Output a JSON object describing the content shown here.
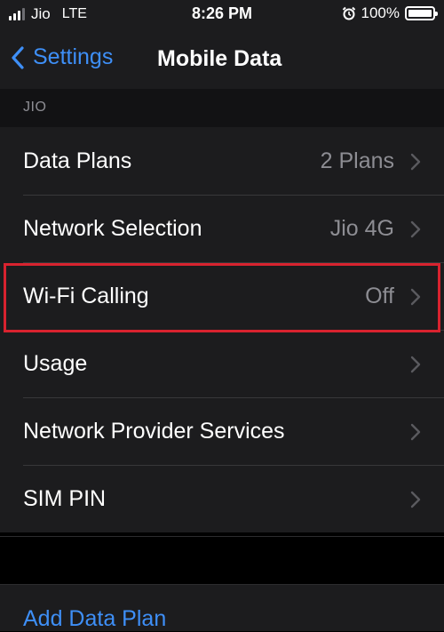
{
  "status_bar": {
    "carrier": "Jio",
    "network": "LTE",
    "time": "8:26 PM",
    "battery": "100%",
    "icons": [
      "signal-bars-icon",
      "alarm-icon",
      "battery-icon"
    ]
  },
  "nav": {
    "back_label": "Settings",
    "title": "Mobile Data"
  },
  "section": {
    "header": "JIO"
  },
  "rows": [
    {
      "label": "Data Plans",
      "value": "2 Plans"
    },
    {
      "label": "Network Selection",
      "value": "Jio 4G"
    },
    {
      "label": "Wi-Fi Calling",
      "value": "Off"
    },
    {
      "label": "Usage",
      "value": ""
    },
    {
      "label": "Network Provider Services",
      "value": ""
    },
    {
      "label": "SIM PIN",
      "value": ""
    }
  ],
  "add_plan": {
    "label": "Add Data Plan"
  },
  "colors": {
    "accent": "#3e8ff7",
    "highlight": "#d8232f",
    "background": "#000000",
    "cell": "#1c1c1e"
  }
}
